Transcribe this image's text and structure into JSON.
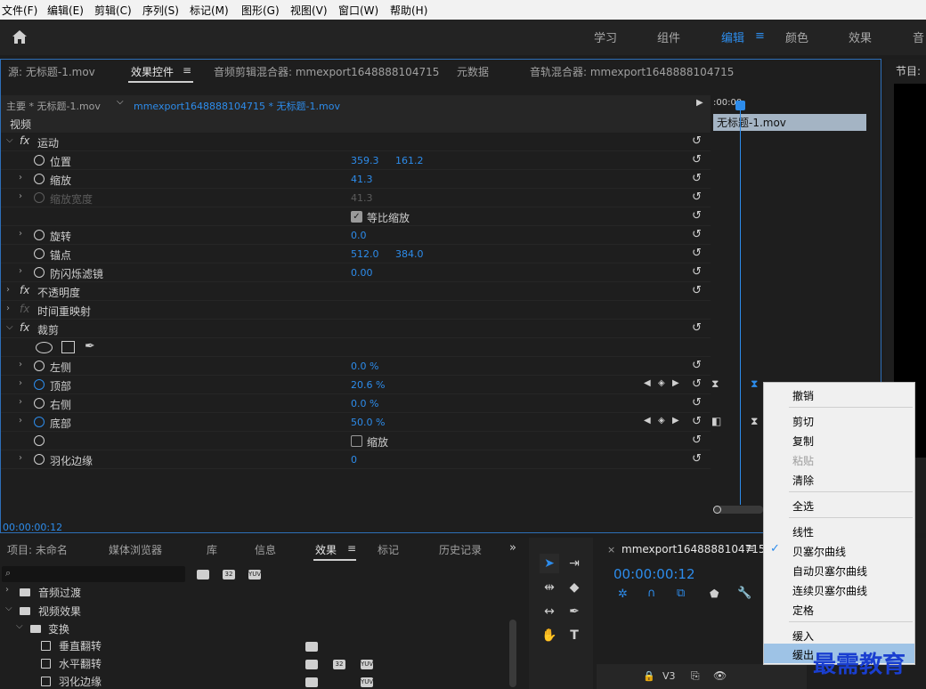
{
  "menubar": [
    "文件(F)",
    "编辑(E)",
    "剪辑(C)",
    "序列(S)",
    "标记(M)",
    "图形(G)",
    "视图(V)",
    "窗口(W)",
    "帮助(H)"
  ],
  "workspaces": [
    "学习",
    "组件",
    "编辑",
    "颜色",
    "效果",
    "音"
  ],
  "tabs": {
    "source": "源: 无标题-1.mov",
    "effect_controls": "效果控件",
    "audio_clip_mixer": "音频剪辑混合器: mmexport1648888104715",
    "metadata": "元数据",
    "audio_track_mixer": "音轨混合器: mmexport1648888104715",
    "program": "节目:"
  },
  "clip_header": {
    "master": "主要 * 无标题-1.mov",
    "sequence": "mmexport1648888104715 * 无标题-1.mov",
    "timecode_start": ":00:00",
    "clip_name": "无标题-1.mov"
  },
  "section_video": "视频",
  "effects": {
    "motion": "运动",
    "position": {
      "label": "位置",
      "v1": "359.3",
      "v2": "161.2"
    },
    "scale": {
      "label": "缩放",
      "v": "41.3"
    },
    "scale_width": {
      "label": "缩放宽度",
      "v": "41.3"
    },
    "uniform_scale": "等比缩放",
    "rotation": {
      "label": "旋转",
      "v": "0.0"
    },
    "anchor": {
      "label": "锚点",
      "v1": "512.0",
      "v2": "384.0"
    },
    "anti_flicker": {
      "label": "防闪烁滤镜",
      "v": "0.00"
    },
    "opacity": "不透明度",
    "time_remap": "时间重映射",
    "crop": "裁剪",
    "left": {
      "label": "左侧",
      "v": "0.0 %"
    },
    "top": {
      "label": "顶部",
      "v": "20.6 %"
    },
    "right": {
      "label": "右侧",
      "v": "0.0 %"
    },
    "bottom": {
      "label": "底部",
      "v": "50.0 %"
    },
    "zoom": "缩放",
    "feather": {
      "label": "羽化边缘",
      "v": "0"
    }
  },
  "ec_timecode": "00:00:00:12",
  "context_menu": {
    "undo": "撤销",
    "cut": "剪切",
    "copy": "复制",
    "paste": "粘贴",
    "clear": "清除",
    "select_all": "全选",
    "linear": "线性",
    "bezier": "贝塞尔曲线",
    "auto_bezier": "自动贝塞尔曲线",
    "continuous_bezier": "连续贝塞尔曲线",
    "hold": "定格",
    "ease_in": "缓入",
    "ease_out": "缓出",
    "check_mark": "✓"
  },
  "bottom_tabs": [
    "项目: 未命名",
    "媒体浏览器",
    "库",
    "信息",
    "效果",
    "标记",
    "历史记录"
  ],
  "effects_tree": {
    "audio_transitions": "音频过渡",
    "video_effects": "视频效果",
    "transform": "变换",
    "vflip": "垂直翻转",
    "hflip": "水平翻转",
    "feather": "羽化边缘"
  },
  "badges": {
    "b32": "32",
    "yuv": "YUV"
  },
  "timeline": {
    "name": "mmexport1648888104715",
    "timecode": "00:00:00:12",
    "track": "V3"
  },
  "watermark": "最需教育",
  "colors": {
    "accent": "#2d8ceb",
    "panel": "#1e1e1e",
    "menu": "#f0f0f0"
  }
}
